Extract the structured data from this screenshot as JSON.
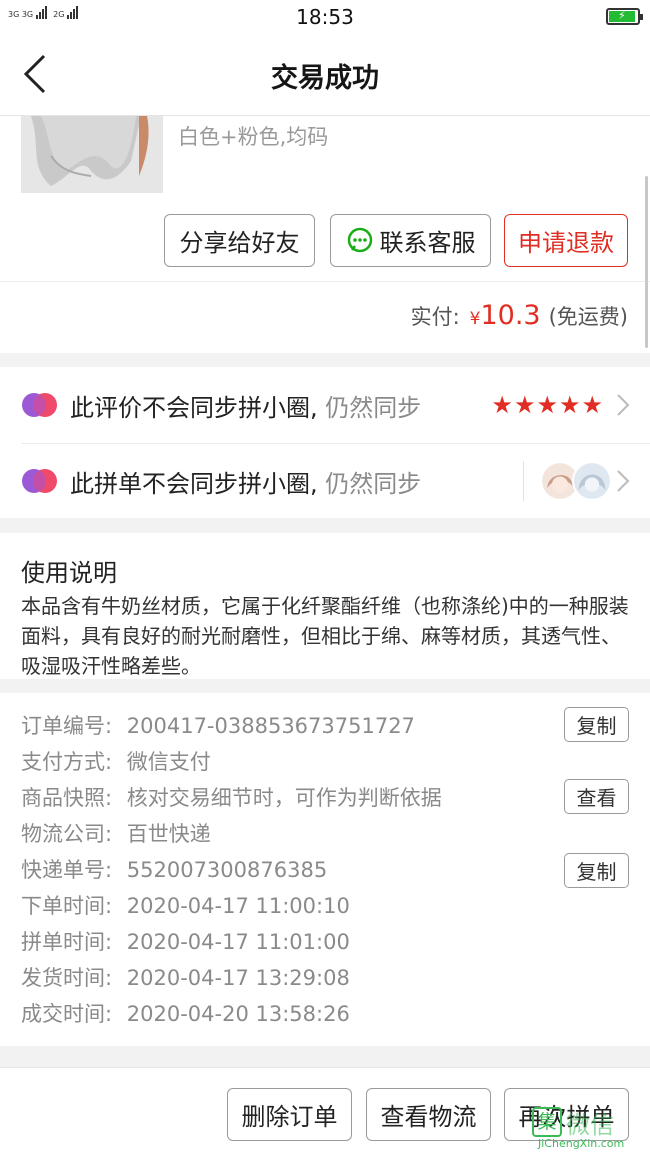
{
  "status_bar": {
    "net1": "3G 3G",
    "net2": "2G",
    "time": "18:53"
  },
  "nav": {
    "title": "交易成功"
  },
  "product": {
    "spec": "白色+粉色,均码",
    "share_label": "分享给好友",
    "contact_label": "联系客服",
    "refund_label": "申请退款",
    "paid_label": "实付:",
    "currency": "¥",
    "amount": "10.3",
    "shipping_note": "(免运费)"
  },
  "sync": {
    "review_text": "此评价不会同步拼小圈,",
    "review_action": "仍然同步",
    "review_stars": "★★★★★",
    "order_text": "此拼单不会同步拼小圈,",
    "order_action": "仍然同步"
  },
  "description": {
    "title": "使用说明",
    "body": "本品含有牛奶丝材质，它属于化纤聚酯纤维（也称涤纶)中的一种服装面料，具有良好的耐光耐磨性，但相比于绵、麻等材质，其透气性、吸湿吸汗性略差些。"
  },
  "order_info": {
    "rows": [
      {
        "label": "订单编号:",
        "value": "200417-038853673751727"
      },
      {
        "label": "支付方式:",
        "value": "微信支付"
      },
      {
        "label": "商品快照:",
        "value": "核对交易细节时，可作为判断依据"
      },
      {
        "label": "物流公司:",
        "value": "百世快递"
      },
      {
        "label": "快递单号:",
        "value": "552007300876385"
      },
      {
        "label": "下单时间:",
        "value": "2020-04-17 11:00:10"
      },
      {
        "label": "拼单时间:",
        "value": "2020-04-17 11:01:00"
      },
      {
        "label": "发货时间:",
        "value": "2020-04-17 13:29:08"
      },
      {
        "label": "成交时间:",
        "value": "2020-04-20 13:58:26"
      }
    ],
    "copy_label": "复制",
    "view_label": "查看"
  },
  "bottom_bar": {
    "delete_label": "删除订单",
    "logistics_label": "查看物流",
    "reorder_label": "再次拼单"
  },
  "watermark": {
    "box": "集",
    "text": "微信",
    "url": "JiChengXin.com"
  },
  "colors": {
    "accent": "#e02e24",
    "wechat": "#1aad19",
    "muted": "#8a8a8a"
  }
}
